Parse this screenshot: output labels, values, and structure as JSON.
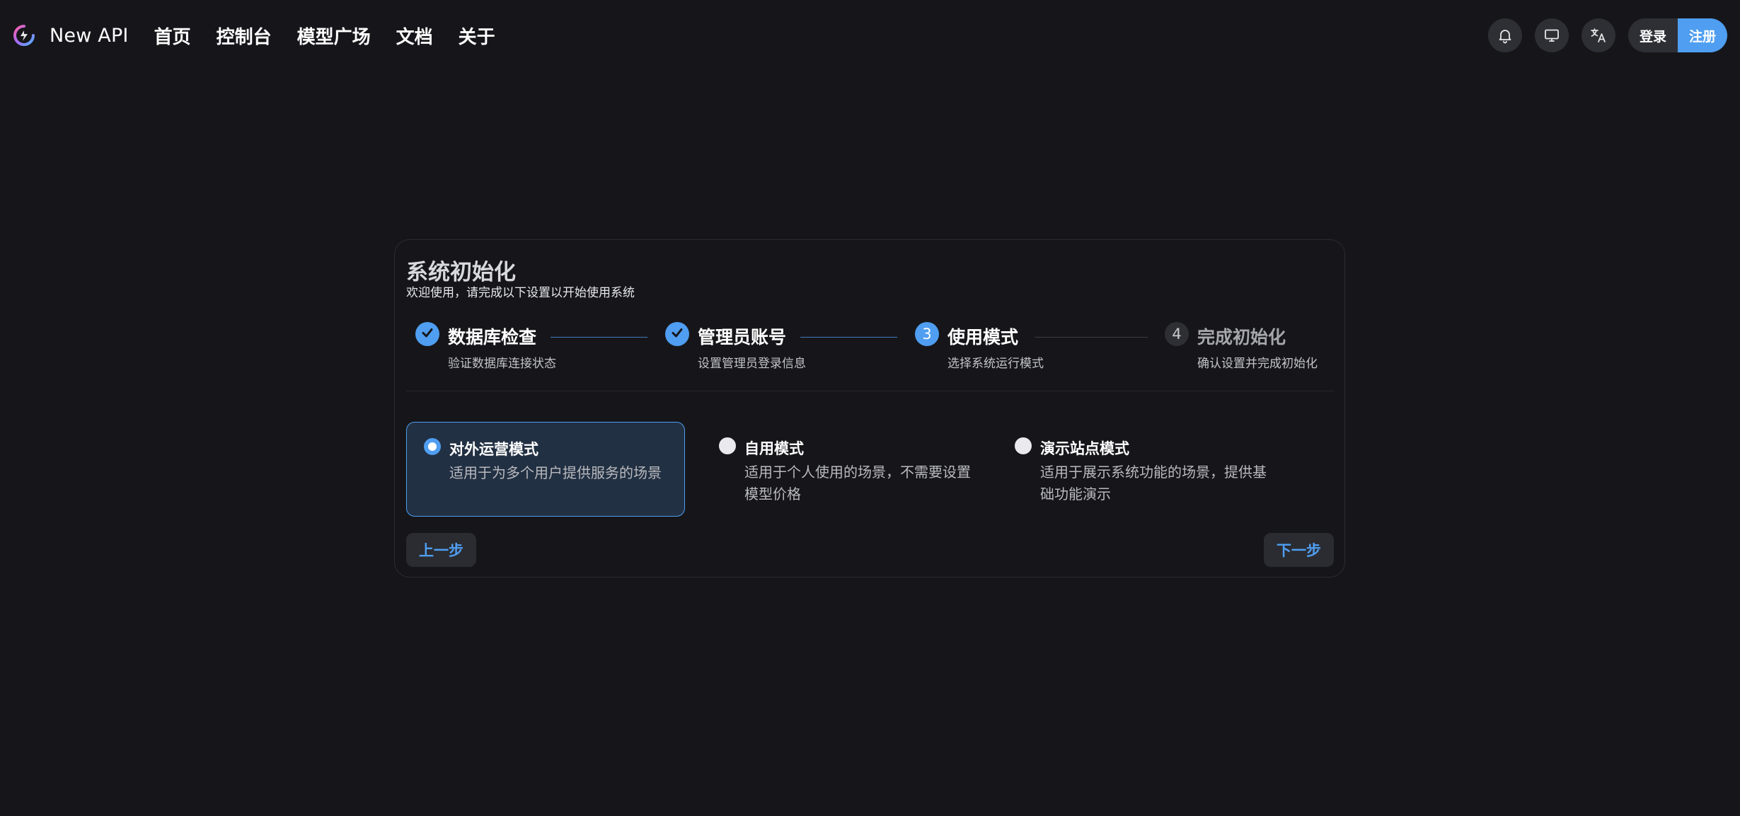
{
  "header": {
    "brand": "New API",
    "logo_icon": "new-api-logo",
    "nav": [
      {
        "label": "首页"
      },
      {
        "label": "控制台"
      },
      {
        "label": "模型广场"
      },
      {
        "label": "文档"
      },
      {
        "label": "关于"
      }
    ],
    "icons": [
      "bell-icon",
      "monitor-icon",
      "translate-icon"
    ],
    "login_label": "登录",
    "register_label": "注册"
  },
  "setup": {
    "title": "系统初始化",
    "subtitle": "欢迎使用，请完成以下设置以开始使用系统",
    "steps": [
      {
        "number": "1",
        "title": "数据库检查",
        "desc": "验证数据库连接状态",
        "status": "done"
      },
      {
        "number": "2",
        "title": "管理员账号",
        "desc": "设置管理员登录信息",
        "status": "done"
      },
      {
        "number": "3",
        "title": "使用模式",
        "desc": "选择系统运行模式",
        "status": "active"
      },
      {
        "number": "4",
        "title": "完成初始化",
        "desc": "确认设置并完成初始化",
        "status": "pending"
      }
    ],
    "modes": [
      {
        "title": "对外运营模式",
        "desc": "适用于为多个用户提供服务的场景",
        "selected": true
      },
      {
        "title": "自用模式",
        "desc": "适用于个人使用的场景，不需要设置模型价格",
        "selected": false
      },
      {
        "title": "演示站点模式",
        "desc": "适用于展示系统功能的场景，提供基础功能演示",
        "selected": false
      }
    ],
    "prev_label": "上一步",
    "next_label": "下一步"
  },
  "colors": {
    "background": "#16161a",
    "accent": "#4f9ef1",
    "selected_bg": "#223043",
    "button_bg": "#2b2c31"
  }
}
